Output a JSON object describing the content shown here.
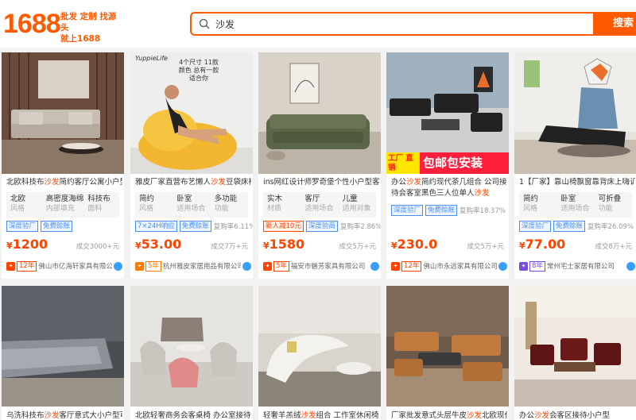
{
  "header": {
    "logo": "1688",
    "slogan": [
      "批发 定制 找源头",
      "就上1688"
    ],
    "search": {
      "value": "沙发",
      "button": "搜索"
    }
  },
  "products": [
    {
      "title_pre": "北欧科技布",
      "title_hl": "沙发",
      "title_post": "简约客厅公寓小户型",
      "attrs": [
        {
          "v": "北欧",
          "k": "风格"
        },
        {
          "v": "高密度海绵",
          "k": "内部填充"
        },
        {
          "v": "科技布",
          "k": "面料"
        }
      ],
      "tags": [
        {
          "t": "深度验厂",
          "c": "blue"
        },
        {
          "t": "免费赊账",
          "c": "blue"
        }
      ],
      "rate": "",
      "price": "1200",
      "deal": "成交3000+元",
      "years": "12年",
      "shop": "佛山市亿海轩家具有限公司",
      "badge": "red"
    },
    {
      "title_pre": "雅皮厂家直营布艺懒人",
      "title_hl": "沙发",
      "title_post": "豆袋床椅",
      "attrs": [
        {
          "v": "简约",
          "k": "风格"
        },
        {
          "v": "卧室",
          "k": "适用场合"
        },
        {
          "v": "多功能",
          "k": "功能"
        }
      ],
      "tags": [
        {
          "t": "7×24H响应",
          "c": "blue"
        },
        {
          "t": "免费赊账",
          "c": "blue"
        }
      ],
      "rate": "复购率6.11%",
      "price": "53.00",
      "deal": "成交7万+元",
      "years": "5年",
      "shop": "杭州雅皮家居用品有限公司",
      "badge": "orange",
      "brand": "YuppieLife",
      "overlay_text": "4个尺寸 11款颜色 总有一款适合你"
    },
    {
      "title_pre": "ins网红设计师罗奇堡个性小户型客",
      "title_hl": "",
      "title_post": "",
      "attrs": [
        {
          "v": "实木",
          "k": "材质"
        },
        {
          "v": "客厅",
          "k": "适用场合"
        },
        {
          "v": "儿童",
          "k": "适用对象"
        }
      ],
      "tags": [
        {
          "t": "新人减10元",
          "c": "red"
        },
        {
          "t": "深度验商",
          "c": "blue"
        }
      ],
      "rate": "复购率2.86%",
      "price": "1580",
      "deal": "成交5万+元",
      "years": "5年",
      "shop": "福安市磬芳家具有限公司",
      "badge": "red"
    },
    {
      "title_pre": "办公",
      "title_hl": "沙发",
      "title_post": "简约现代茶几组合 公司接",
      "title2_pre": "待会客室黑色三人位单人",
      "title2_hl": "沙发",
      "attrs": [],
      "tags": [
        {
          "t": "深度验厂",
          "c": "blue"
        },
        {
          "t": "免费赊账",
          "c": "blue"
        }
      ],
      "rate": "复购率18.37%",
      "price": "230.0",
      "deal": "成交5万+元",
      "years": "12年",
      "shop": "佛山市永远家具有限公司",
      "badge": "red",
      "banner_left": "工厂 直销",
      "banner_right": "包邮包安装"
    },
    {
      "title_pre": "1【厂家】靠山椅飘窗靠背床上嗨讥",
      "title_hl": "",
      "title_post": "",
      "attrs": [
        {
          "v": "简约",
          "k": "风格"
        },
        {
          "v": "卧室",
          "k": "适用场合"
        },
        {
          "v": "可折叠",
          "k": "功能"
        }
      ],
      "tags": [
        {
          "t": "深度验厂",
          "c": "blue"
        },
        {
          "t": "免费赊账",
          "c": "blue"
        }
      ],
      "rate": "复购率26.09%",
      "price": "77.00",
      "deal": "成交8万+元",
      "years": "8年",
      "shop": "常州宅士家居有限公司",
      "badge": "purple"
    },
    {
      "title_pre": "乌洗科技布",
      "title_hl": "沙发",
      "title_post": "客厅意式大小户型可"
    },
    {
      "title_pre": "北欧轻奢商务会客桌椅 办公室接待",
      "title_hl": "",
      "title_post": ""
    },
    {
      "title_pre": "轻奢羊羔绒",
      "title_hl": "沙发",
      "title_post": "组合 工作室休闲椅"
    },
    {
      "title_pre": "厂家批发意式头层牛皮",
      "title_hl": "沙发",
      "title_post": "北欧现代"
    },
    {
      "title_pre": "办公",
      "title_hl": "沙发",
      "title_post": "会客区接待小户型"
    }
  ],
  "colors": {
    "brand": "#ff5a00",
    "price": "#ff4400"
  }
}
